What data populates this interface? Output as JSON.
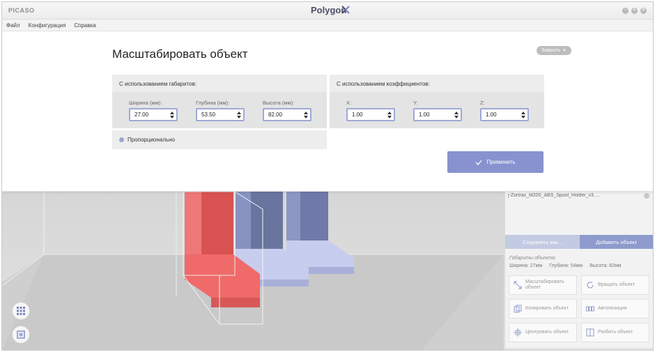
{
  "app": {
    "brand": "PICASO",
    "title": "Polygon"
  },
  "menu": {
    "items": [
      "Файл",
      "Конфигурация",
      "Справка"
    ]
  },
  "dialog": {
    "title": "Масштабировать объект",
    "close_label": "Закрыть",
    "dimensions_group": {
      "title": "С использованием габаритов:",
      "fields": [
        {
          "label": "Ширина (мм):",
          "value": "27.00"
        },
        {
          "label": "Глубина (мм):",
          "value": "53.50"
        },
        {
          "label": "Высота (мм):",
          "value": "82.00"
        }
      ]
    },
    "factors_group": {
      "title": "С использованием коэффициентов:",
      "fields": [
        {
          "label": "X:",
          "value": "1.00"
        },
        {
          "label": "Y:",
          "value": "1.00"
        },
        {
          "label": "Z:",
          "value": "1.00"
        }
      ]
    },
    "proportional_label": "Пропорционально",
    "apply_label": "Применить"
  },
  "right_panel": {
    "filename": "j-Zortrax_M200_ABS_Spool_Holder_v3.…",
    "save_as_label": "Сохранить как...",
    "add_object_label": "Добавить объект",
    "dims_label": "Габариты объекта:",
    "dims": {
      "width": "Ширина: 27мм",
      "depth": "Глубина: 54мм",
      "height": "Высота: 82мм"
    },
    "actions": {
      "scale": "Масштабировать объект",
      "rotate": "Вращать объект",
      "copy": "Копировать объект",
      "autoposition": "Автопозиция",
      "center": "Центровать объект",
      "split": "Разбить объект"
    }
  },
  "colors": {
    "accent": "#8792cf",
    "input_border": "#9ea9d6",
    "object_selected": "#f06a6a",
    "object_normal": "#c7cdee"
  },
  "icons": {
    "grid": "grid-icon",
    "layers": "layers-icon"
  }
}
